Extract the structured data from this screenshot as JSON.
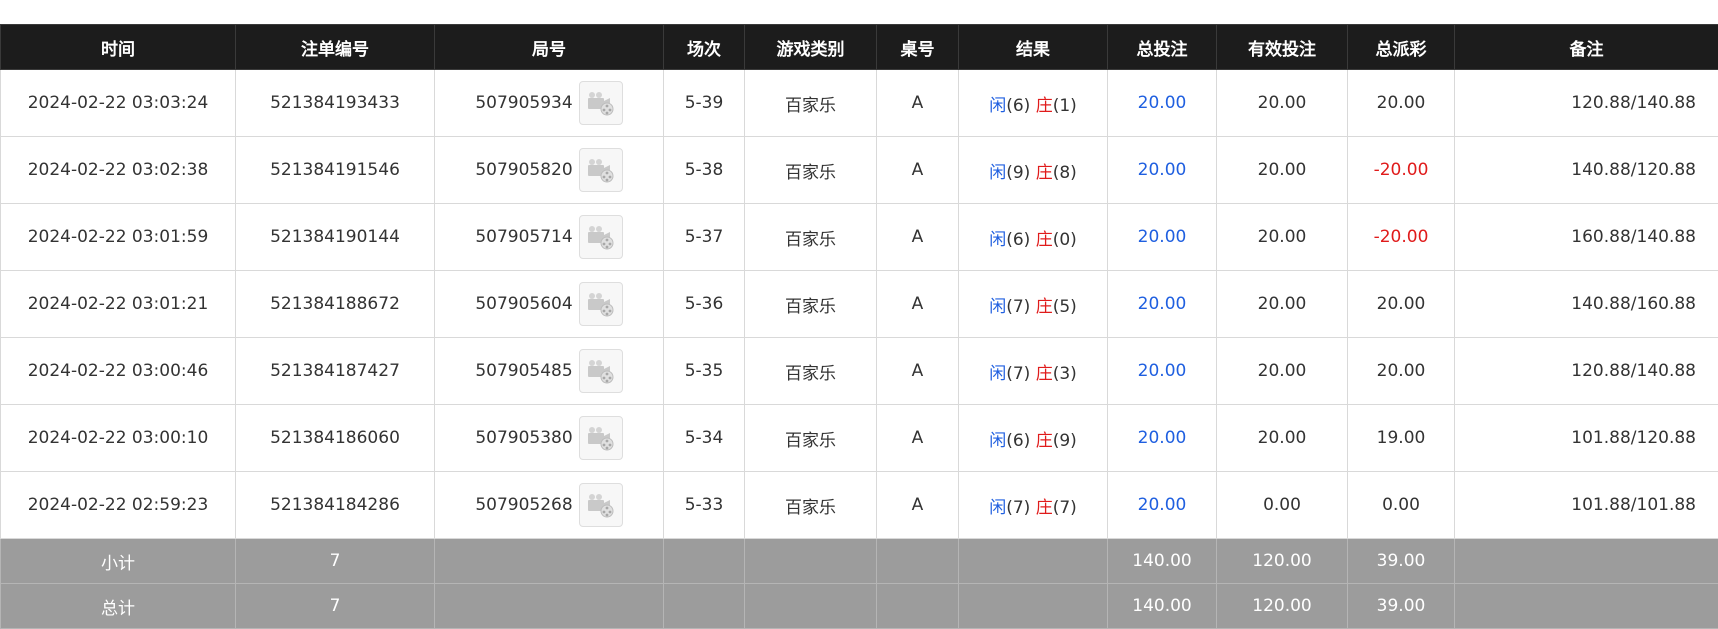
{
  "columns": [
    "时间",
    "注单编号",
    "局号",
    "场次",
    "游戏类别",
    "桌号",
    "结果",
    "总投注",
    "有效投注",
    "总派彩",
    "备注"
  ],
  "result_labels": {
    "player": "闲",
    "banker": "庄"
  },
  "colors": {
    "header_bg": "#1c1c1c",
    "footer_bg": "#9c9c9c",
    "blue": "#1f5fe0",
    "red": "#e01b1b"
  },
  "replay_icon": "film-reel-icon",
  "rows": [
    {
      "time": "2024-02-22 03:03:24",
      "bet_id": "521384193433",
      "round": "507905934",
      "session": "5-39",
      "game": "百家乐",
      "table": "A",
      "player": "(6)",
      "banker": "(1)",
      "total_bet": "20.00",
      "valid_bet": "20.00",
      "payout": "20.00",
      "payout_negative": false,
      "note": "120.88/140.88"
    },
    {
      "time": "2024-02-22 03:02:38",
      "bet_id": "521384191546",
      "round": "507905820",
      "session": "5-38",
      "game": "百家乐",
      "table": "A",
      "player": "(9)",
      "banker": "(8)",
      "total_bet": "20.00",
      "valid_bet": "20.00",
      "payout": "-20.00",
      "payout_negative": true,
      "note": "140.88/120.88"
    },
    {
      "time": "2024-02-22 03:01:59",
      "bet_id": "521384190144",
      "round": "507905714",
      "session": "5-37",
      "game": "百家乐",
      "table": "A",
      "player": "(6)",
      "banker": "(0)",
      "total_bet": "20.00",
      "valid_bet": "20.00",
      "payout": "-20.00",
      "payout_negative": true,
      "note": "160.88/140.88"
    },
    {
      "time": "2024-02-22 03:01:21",
      "bet_id": "521384188672",
      "round": "507905604",
      "session": "5-36",
      "game": "百家乐",
      "table": "A",
      "player": "(7)",
      "banker": "(5)",
      "total_bet": "20.00",
      "valid_bet": "20.00",
      "payout": "20.00",
      "payout_negative": false,
      "note": "140.88/160.88"
    },
    {
      "time": "2024-02-22 03:00:46",
      "bet_id": "521384187427",
      "round": "507905485",
      "session": "5-35",
      "game": "百家乐",
      "table": "A",
      "player": "(7)",
      "banker": "(3)",
      "total_bet": "20.00",
      "valid_bet": "20.00",
      "payout": "20.00",
      "payout_negative": false,
      "note": "120.88/140.88"
    },
    {
      "time": "2024-02-22 03:00:10",
      "bet_id": "521384186060",
      "round": "507905380",
      "session": "5-34",
      "game": "百家乐",
      "table": "A",
      "player": "(6)",
      "banker": "(9)",
      "total_bet": "20.00",
      "valid_bet": "20.00",
      "payout": "19.00",
      "payout_negative": false,
      "note": "101.88/120.88"
    },
    {
      "time": "2024-02-22 02:59:23",
      "bet_id": "521384184286",
      "round": "507905268",
      "session": "5-33",
      "game": "百家乐",
      "table": "A",
      "player": "(7)",
      "banker": "(7)",
      "total_bet": "20.00",
      "valid_bet": "0.00",
      "payout": "0.00",
      "payout_negative": false,
      "note": "101.88/101.88"
    }
  ],
  "subtotal": {
    "label": "小计",
    "count": "7",
    "total_bet": "140.00",
    "valid_bet": "120.00",
    "payout": "39.00"
  },
  "total": {
    "label": "总计",
    "count": "7",
    "total_bet": "140.00",
    "valid_bet": "120.00",
    "payout": "39.00"
  }
}
